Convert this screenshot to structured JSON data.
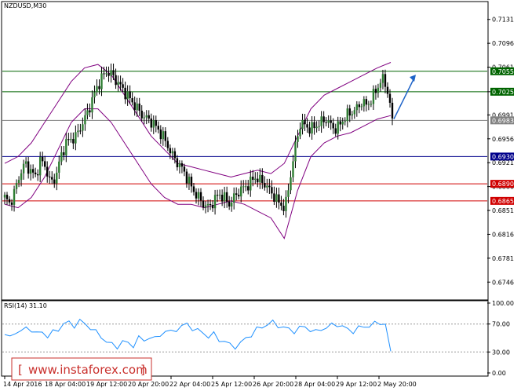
{
  "chart_data": {
    "type": "candlestick",
    "symbol_label": "NZDUSD,M30",
    "y_ticks": [
      "0.7131",
      "0.7096",
      "0.7061",
      "0.7025",
      "0.6991",
      "0.6956",
      "0.6921",
      "0.6886",
      "0.6851",
      "0.6816",
      "0.6781",
      "0.6746"
    ],
    "ylim": [
      0.6721,
      0.7156
    ],
    "x_ticks": [
      "14 Apr 2016",
      "18 Apr 04:00",
      "19 Apr 12:00",
      "20 Apr 20:00",
      "22 Apr 04:00",
      "25 Apr 12:00",
      "26 Apr 20:00",
      "28 Apr 04:00",
      "29 Apr 12:00",
      "2 May 20:00"
    ],
    "levels": [
      {
        "label": "0.7055",
        "value": 0.7055,
        "color": "#006400"
      },
      {
        "label": "0.7025",
        "value": 0.7025,
        "color": "#006400"
      },
      {
        "label": "0.6983",
        "value": 0.6983,
        "color": "#808080"
      },
      {
        "label": "0.6930",
        "value": 0.693,
        "color": "#00008b"
      },
      {
        "label": "0.6890",
        "value": 0.689,
        "color": "#d00000"
      },
      {
        "label": "0.6865",
        "value": 0.6865,
        "color": "#d00000"
      }
    ],
    "price_path": [
      0.687,
      0.686,
      0.688,
      0.6905,
      0.692,
      0.691,
      0.69,
      0.6925,
      0.6915,
      0.689,
      0.69,
      0.693,
      0.695,
      0.6955,
      0.696,
      0.6975,
      0.699,
      0.701,
      0.703,
      0.7045,
      0.7055,
      0.705,
      0.704,
      0.703,
      0.702,
      0.701,
      0.7,
      0.699,
      0.6985,
      0.698,
      0.697,
      0.696,
      0.6945,
      0.693,
      0.692,
      0.691,
      0.6895,
      0.688,
      0.687,
      0.686,
      0.6855,
      0.6865,
      0.6875,
      0.687,
      0.686,
      0.687,
      0.688,
      0.6885,
      0.689,
      0.69,
      0.6895,
      0.689,
      0.688,
      0.687,
      0.686,
      0.6855,
      0.69,
      0.6945,
      0.698,
      0.6975,
      0.697,
      0.6975,
      0.698,
      0.6985,
      0.6975,
      0.697,
      0.698,
      0.699,
      0.6995,
      0.7,
      0.701,
      0.7005,
      0.7015,
      0.703,
      0.7045,
      0.703,
      0.6983
    ],
    "bb_upper": [
      0.692,
      0.693,
      0.695,
      0.698,
      0.701,
      0.704,
      0.706,
      0.7065,
      0.705,
      0.702,
      0.699,
      0.696,
      0.694,
      0.692,
      0.6915,
      0.691,
      0.6905,
      0.69,
      0.6905,
      0.691,
      0.6905,
      0.692,
      0.696,
      0.7,
      0.702,
      0.703,
      0.704,
      0.705,
      0.706,
      0.7068
    ],
    "bb_lower": [
      0.686,
      0.6855,
      0.687,
      0.69,
      0.694,
      0.698,
      0.7,
      0.7,
      0.698,
      0.695,
      0.692,
      0.689,
      0.687,
      0.686,
      0.686,
      0.6855,
      0.686,
      0.6865,
      0.686,
      0.685,
      0.684,
      0.681,
      0.688,
      0.693,
      0.695,
      0.696,
      0.6965,
      0.6975,
      0.6985,
      0.699
    ],
    "forecast_arrow": {
      "from": 0.6985,
      "to": 0.705,
      "color": "#1e63c8"
    },
    "rsi": {
      "label": "RSI(14) 31.10",
      "ticks": [
        "100.00",
        "70.00",
        "30.00",
        "0.00"
      ],
      "levels": [
        70,
        30
      ],
      "values": [
        55,
        50,
        60,
        58,
        65,
        62,
        55,
        60,
        52,
        58,
        63,
        70,
        72,
        68,
        74,
        70,
        65,
        58,
        52,
        45,
        40,
        38,
        45,
        42,
        40,
        50,
        46,
        52,
        48,
        55,
        60,
        58,
        63,
        66,
        70,
        64,
        60,
        58,
        52,
        55,
        48,
        45,
        40,
        38,
        42,
        50,
        55,
        62,
        66,
        70,
        72,
        68,
        65,
        62,
        60,
        64,
        66,
        62,
        58,
        63,
        65,
        68,
        70,
        66,
        62,
        60,
        64,
        66,
        68,
        70,
        72,
        70,
        31
      ]
    }
  },
  "watermark": {
    "bracket": "[",
    "text": "www.instaforex.com",
    "bracket_close": "]"
  }
}
